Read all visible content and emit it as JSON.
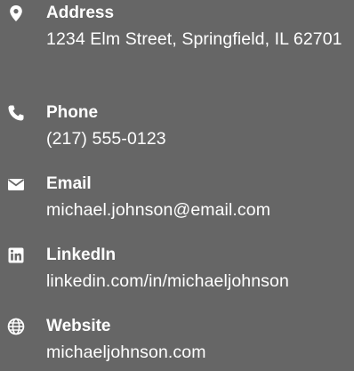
{
  "contacts": {
    "address": {
      "icon": "map-marker-icon",
      "label": "Address",
      "value": "1234 Elm Street, Springfield, IL 62701"
    },
    "phone": {
      "icon": "phone-icon",
      "label": "Phone",
      "value": "(217) 555-0123"
    },
    "email": {
      "icon": "envelope-icon",
      "label": "Email",
      "value": "michael.johnson@email.com"
    },
    "linkedin": {
      "icon": "linkedin-icon",
      "label": "LinkedIn",
      "value": "linkedin.com/in/michaeljohnson"
    },
    "website": {
      "icon": "globe-icon",
      "label": "Website",
      "value": "michaeljohnson.com"
    }
  },
  "colors": {
    "background": "#666666",
    "text": "#ffffff"
  }
}
